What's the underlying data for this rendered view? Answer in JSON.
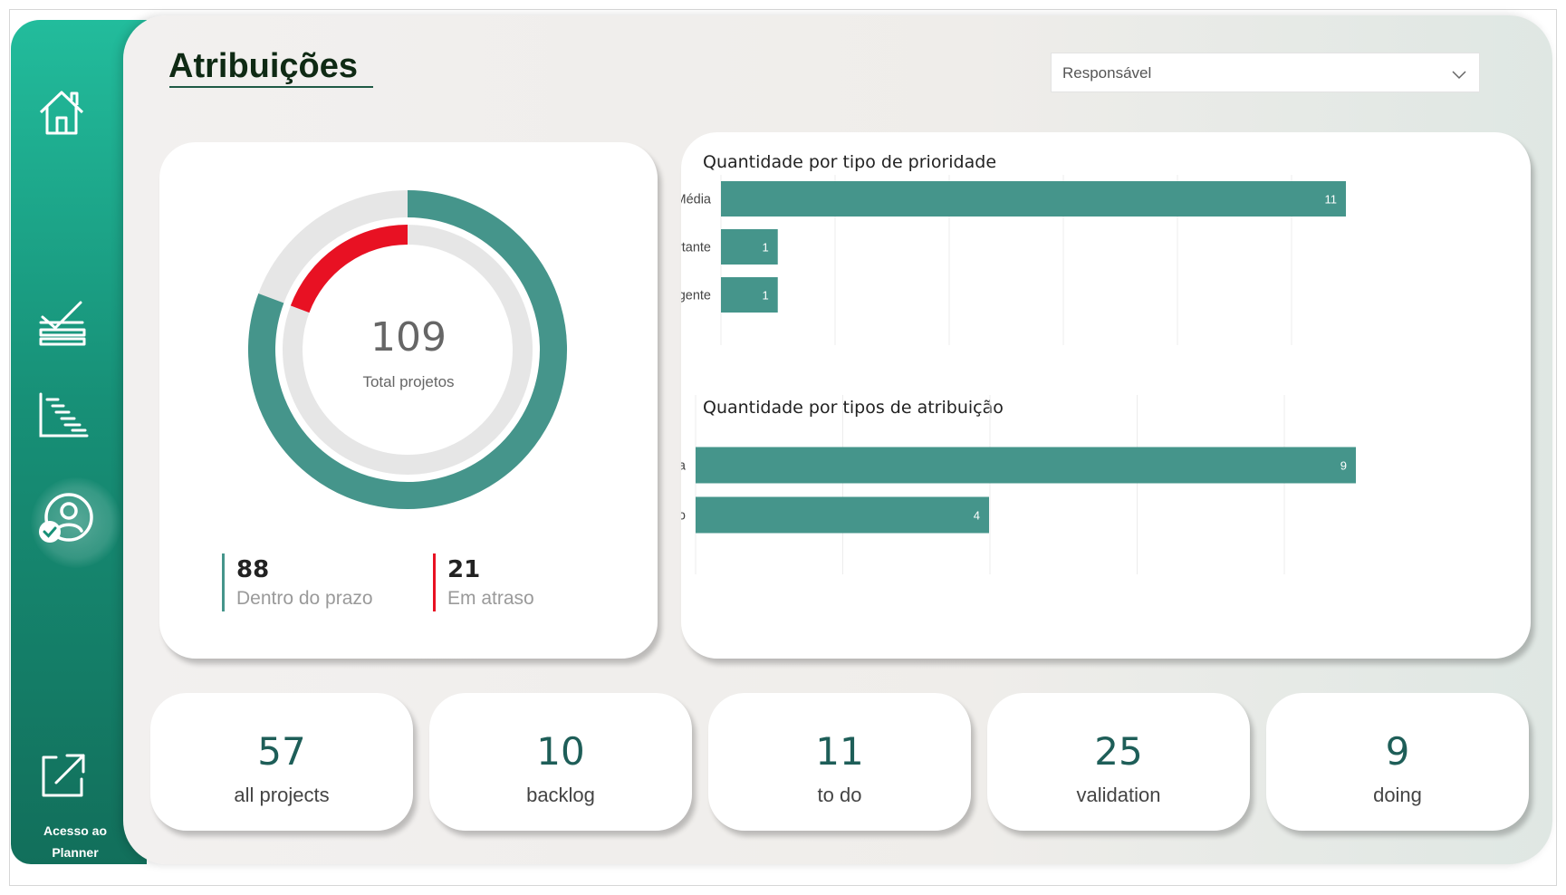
{
  "page": {
    "title": "Atribuições"
  },
  "sidebar": {
    "items": [
      {
        "name": "home",
        "icon": "home-icon"
      },
      {
        "name": "tasks",
        "icon": "task-checklist-icon"
      },
      {
        "name": "gantt",
        "icon": "gantt-chart-icon"
      },
      {
        "name": "assignments",
        "icon": "user-check-icon",
        "active": true
      }
    ],
    "planner": {
      "icon": "external-link-icon",
      "label_line1": "Acesso ao",
      "label_line2": "Planner"
    }
  },
  "filter": {
    "value": "Responsável",
    "icon": "chevron-down-icon"
  },
  "donut": {
    "total": "109",
    "total_label": "Total projetos",
    "on_time": {
      "value": "88",
      "label": "Dentro do prazo",
      "color": "#45958b"
    },
    "late": {
      "value": "21",
      "label": "Em atraso",
      "color": "#e81123"
    }
  },
  "chart_data": [
    {
      "type": "bar",
      "orientation": "horizontal",
      "title": "Quantidade por tipo de prioridade",
      "categories": [
        "Média",
        "Importante",
        "Urgente"
      ],
      "values": [
        11,
        1,
        1
      ],
      "xlim": [
        0,
        11
      ],
      "grid": true,
      "color": "#45958b"
    },
    {
      "type": "bar",
      "orientation": "horizontal",
      "title": "Quantidade por tipos de atribuição",
      "categories": [
        "Rotina",
        "Projeto"
      ],
      "values": [
        9,
        4
      ],
      "xlim": [
        0,
        9
      ],
      "grid": true,
      "color": "#45958b"
    }
  ],
  "kpis": [
    {
      "value": "57",
      "label": "all projects"
    },
    {
      "value": "10",
      "label": "backlog"
    },
    {
      "value": "11",
      "label": "to do"
    },
    {
      "value": "25",
      "label": "validation"
    },
    {
      "value": "9",
      "label": "doing"
    }
  ],
  "colors": {
    "accent": "#45958b",
    "sidebar_top": "#22bc9c",
    "sidebar_bottom": "#126f5b",
    "late": "#e81123",
    "kpi_text": "#1e5e58"
  }
}
